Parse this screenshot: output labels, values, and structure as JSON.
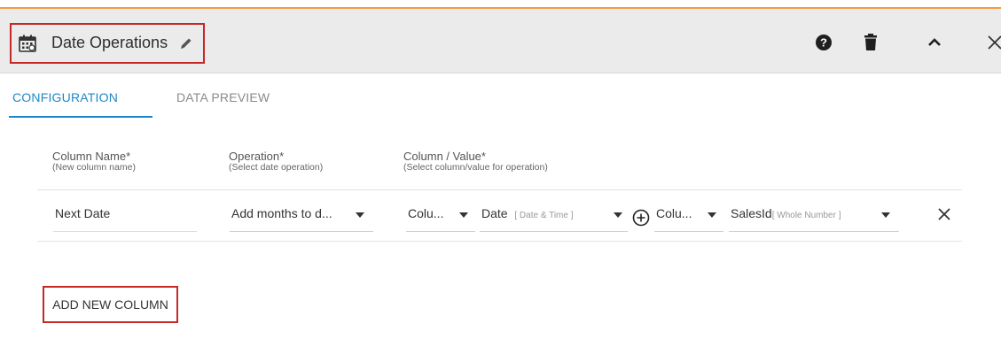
{
  "colors": {
    "accent_top": "#f39c3d",
    "tab_active": "#1e88c7",
    "highlight_box": "#c62828",
    "header_bg": "#ebebeb"
  },
  "header": {
    "title": "Date Operations",
    "icons": [
      "calendar-icon",
      "pencil-icon",
      "help-icon",
      "trash-icon",
      "chevron-up-icon",
      "close-icon"
    ]
  },
  "tabs": [
    {
      "label": "CONFIGURATION",
      "active": true
    },
    {
      "label": "DATA PREVIEW",
      "active": false
    }
  ],
  "columns": [
    {
      "label": "Column Name*",
      "sub": "(New column name)"
    },
    {
      "label": "Operation*",
      "sub": "(Select date operation)"
    },
    {
      "label": "Column / Value*",
      "sub": "(Select column/value for operation)"
    }
  ],
  "row": {
    "column_name": "Next Date",
    "operation": "Add months to d...",
    "arg1_type": "Colu...",
    "arg1_value": "Date",
    "arg1_hint": "[ Date & Time ]",
    "arg2_type": "Colu...",
    "arg2_value": "SalesId",
    "arg2_hint": "[ Whole Number ]"
  },
  "add_button_label": "ADD NEW COLUMN"
}
